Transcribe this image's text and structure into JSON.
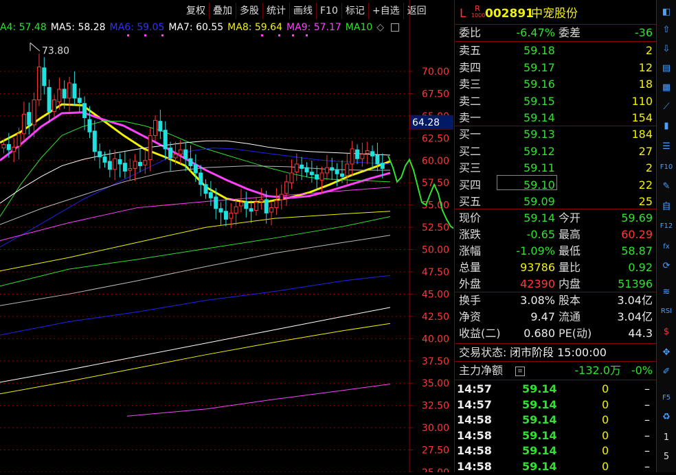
{
  "toolbar_top": [
    "复权",
    "叠加",
    "多股",
    "统计",
    "画线",
    "F10",
    "标记",
    "+自选",
    "返回"
  ],
  "ma_legend": [
    {
      "label": "A4: 57.48",
      "color": "#2fe22f"
    },
    {
      "label": "MA5: 58.28",
      "color": "#ffffff"
    },
    {
      "label": "MA6: 59.05",
      "color": "#3030ff"
    },
    {
      "label": "MA7: 60.55",
      "color": "#ffffff"
    },
    {
      "label": "MA8: 59.64",
      "color": "#f2f200"
    },
    {
      "label": "MA9: 57.17",
      "color": "#ff40ff"
    },
    {
      "label": "MA10",
      "color": "#2fe22f"
    }
  ],
  "chart_data": {
    "type": "candlestick",
    "y_ticks": [
      "70.00",
      "67.50",
      "65.00",
      "62.50",
      "60.00",
      "57.50",
      "55.00",
      "52.50",
      "50.00",
      "47.50",
      "45.00",
      "42.50",
      "40.00",
      "37.50",
      "35.00",
      "32.50",
      "30.00",
      "27.50",
      "25.00"
    ],
    "ylim": [
      25.0,
      72.6
    ],
    "high_label": "73.80",
    "current_price_label": "64.28",
    "closes": [
      61.8,
      61.2,
      61.5,
      63.0,
      65.2,
      64.0,
      66.8,
      70.5,
      68.4,
      65.5,
      66.8,
      68.0,
      67.0,
      68.7,
      67.0,
      66.5,
      64.8,
      63.2,
      61.0,
      60.4,
      59.8,
      59.0,
      60.2,
      59.6,
      58.8,
      59.1,
      59.9,
      59.4,
      60.0,
      62.8,
      64.5,
      63.3,
      61.3,
      60.3,
      60.7,
      61.2,
      60.2,
      59.4,
      58.6,
      57.3,
      56.3,
      55.8,
      54.6,
      54.2,
      53.4,
      54.1,
      54.8,
      55.3,
      54.6,
      54.3,
      55.3,
      55.6,
      54.1,
      54.7,
      55.5,
      56.2,
      57.6,
      58.6,
      59.6,
      59.1,
      58.7,
      58.4,
      57.9,
      58.6,
      59.2,
      58.9,
      58.5,
      58.2,
      59.6,
      61.3,
      60.2,
      60.7,
      61.1,
      60.5,
      59.6,
      59.1
    ],
    "opens": [
      61.4,
      61.8,
      61.0,
      61.6,
      63.0,
      65.4,
      64.0,
      66.8,
      70.4,
      68.2,
      65.5,
      66.6,
      68.0,
      67.0,
      68.6,
      67.0,
      66.4,
      64.6,
      63.3,
      61.0,
      60.4,
      59.9,
      59.0,
      60.1,
      59.7,
      58.9,
      59.1,
      59.8,
      59.5,
      60.1,
      62.8,
      64.4,
      63.4,
      61.4,
      60.3,
      60.7,
      61.2,
      60.2,
      59.5,
      58.6,
      57.3,
      56.4,
      55.9,
      54.6,
      54.3,
      53.5,
      54.1,
      54.9,
      55.3,
      54.6,
      54.4,
      55.4,
      55.6,
      54.2,
      54.7,
      55.6,
      56.3,
      57.5,
      58.7,
      59.5,
      59.2,
      58.7,
      58.4,
      57.8,
      58.6,
      59.2,
      58.9,
      58.5,
      58.3,
      59.6,
      61.2,
      60.2,
      60.8,
      61.0,
      60.6,
      59.7
    ],
    "forecast_path": [
      [
        565,
        60.5
      ],
      [
        572,
        59.2
      ],
      [
        578,
        57.6
      ],
      [
        584,
        58.1
      ],
      [
        590,
        59.4
      ],
      [
        596,
        60.1
      ],
      [
        602,
        58.9
      ],
      [
        608,
        57.1
      ],
      [
        614,
        55.3
      ],
      [
        620,
        55.0
      ],
      [
        626,
        56.2
      ],
      [
        632,
        57.3
      ],
      [
        638,
        56.3
      ],
      [
        644,
        54.4
      ],
      [
        650,
        53.4
      ],
      [
        656,
        52.6
      ],
      [
        662,
        52.3
      ],
      [
        668,
        51.6
      ],
      [
        676,
        50.9
      ],
      [
        684,
        50.1
      ],
      [
        692,
        49.3
      ],
      [
        700,
        48.9
      ],
      [
        708,
        48.1
      ],
      [
        716,
        46.8
      ],
      [
        722,
        46.5
      ]
    ],
    "ma_lines": [
      {
        "name": "MA8",
        "color": "#f2f200",
        "width": 3,
        "values": [
          [
            0,
            62.0
          ],
          [
            30,
            63.2
          ],
          [
            60,
            64.8
          ],
          [
            90,
            66.3
          ],
          [
            120,
            66.2
          ],
          [
            150,
            64.5
          ],
          [
            180,
            62.8
          ],
          [
            210,
            61.3
          ],
          [
            240,
            60.4
          ],
          [
            270,
            59.4
          ],
          [
            300,
            57.0
          ],
          [
            330,
            55.7
          ],
          [
            360,
            55.3
          ],
          [
            390,
            55.4
          ],
          [
            420,
            55.8
          ],
          [
            450,
            56.4
          ],
          [
            480,
            57.3
          ],
          [
            510,
            58.3
          ],
          [
            540,
            59.1
          ],
          [
            568,
            59.9
          ]
        ]
      },
      {
        "name": "MA9",
        "color": "#ff40ff",
        "width": 3,
        "values": [
          [
            0,
            60.0
          ],
          [
            30,
            61.8
          ],
          [
            60,
            63.8
          ],
          [
            90,
            65.3
          ],
          [
            120,
            65.4
          ],
          [
            150,
            64.6
          ],
          [
            180,
            63.9
          ],
          [
            210,
            62.7
          ],
          [
            240,
            61.5
          ],
          [
            270,
            60.2
          ],
          [
            300,
            58.9
          ],
          [
            330,
            57.8
          ],
          [
            360,
            56.8
          ],
          [
            390,
            56.0
          ],
          [
            420,
            55.8
          ],
          [
            450,
            56.0
          ],
          [
            480,
            56.6
          ],
          [
            510,
            57.3
          ],
          [
            540,
            58.0
          ],
          [
            568,
            58.6
          ]
        ]
      },
      {
        "name": "MA10",
        "color": "#2fe22f",
        "width": 1,
        "values": [
          [
            0,
            53.7
          ],
          [
            30,
            57.3
          ],
          [
            60,
            60.3
          ],
          [
            90,
            62.8
          ],
          [
            120,
            63.8
          ],
          [
            150,
            64.4
          ],
          [
            180,
            64.4
          ],
          [
            210,
            63.9
          ],
          [
            240,
            63.2
          ],
          [
            270,
            62.2
          ],
          [
            300,
            61.3
          ],
          [
            330,
            60.6
          ],
          [
            360,
            59.9
          ],
          [
            390,
            59.2
          ],
          [
            420,
            58.6
          ],
          [
            450,
            58.1
          ],
          [
            480,
            57.9
          ],
          [
            510,
            57.8
          ],
          [
            540,
            57.7
          ],
          [
            568,
            57.6
          ]
        ]
      },
      {
        "name": "MA7",
        "color": "#ffffff",
        "width": 1,
        "values": [
          [
            0,
            55.2
          ],
          [
            30,
            56.8
          ],
          [
            60,
            58.2
          ],
          [
            90,
            59.4
          ],
          [
            120,
            60.1
          ],
          [
            150,
            60.6
          ],
          [
            180,
            61.0
          ],
          [
            210,
            61.4
          ],
          [
            240,
            61.7
          ],
          [
            270,
            62.0
          ],
          [
            300,
            62.2
          ],
          [
            330,
            62.2
          ],
          [
            360,
            61.9
          ],
          [
            390,
            61.5
          ],
          [
            420,
            61.2
          ],
          [
            450,
            61.0
          ],
          [
            480,
            60.9
          ],
          [
            510,
            60.8
          ],
          [
            540,
            60.7
          ],
          [
            568,
            60.6
          ]
        ]
      },
      {
        "name": "MA6",
        "color": "#2222ee",
        "width": 1,
        "values": [
          [
            0,
            50.3
          ],
          [
            40,
            52.0
          ],
          [
            80,
            53.8
          ],
          [
            120,
            55.6
          ],
          [
            160,
            57.1
          ],
          [
            200,
            58.6
          ],
          [
            240,
            60.1
          ],
          [
            280,
            61.1
          ],
          [
            310,
            61.4
          ],
          [
            340,
            61.3
          ],
          [
            370,
            61.0
          ],
          [
            400,
            60.7
          ],
          [
            430,
            60.4
          ],
          [
            460,
            60.1
          ],
          [
            490,
            59.9
          ],
          [
            520,
            59.8
          ],
          [
            568,
            59.6
          ]
        ]
      },
      {
        "name": "MA5",
        "color": "#bbbbbb",
        "width": 1,
        "values": [
          [
            0,
            52.8
          ],
          [
            60,
            54.6
          ],
          [
            120,
            56.1
          ],
          [
            180,
            57.6
          ],
          [
            240,
            58.7
          ],
          [
            300,
            59.2
          ],
          [
            360,
            59.4
          ],
          [
            420,
            59.3
          ],
          [
            480,
            59.0
          ],
          [
            530,
            58.9
          ],
          [
            568,
            58.9
          ]
        ]
      },
      {
        "name": "L1",
        "color": "#ff40ff",
        "width": 1,
        "values": [
          [
            0,
            51.0
          ],
          [
            100,
            53.0
          ],
          [
            200,
            54.7
          ],
          [
            300,
            55.4
          ],
          [
            400,
            56.0
          ],
          [
            500,
            56.6
          ],
          [
            568,
            57.0
          ]
        ]
      },
      {
        "name": "L2",
        "color": "#f2f200",
        "width": 1,
        "values": [
          [
            0,
            47.6
          ],
          [
            100,
            49.1
          ],
          [
            200,
            50.8
          ],
          [
            300,
            52.5
          ],
          [
            400,
            53.5
          ],
          [
            500,
            54.0
          ],
          [
            568,
            54.3
          ]
        ]
      },
      {
        "name": "L3",
        "color": "#2fe22f",
        "width": 1,
        "values": [
          [
            0,
            45.9
          ],
          [
            100,
            47.8
          ],
          [
            200,
            48.9
          ],
          [
            300,
            50.1
          ],
          [
            400,
            51.3
          ],
          [
            500,
            52.6
          ],
          [
            568,
            53.7
          ]
        ]
      },
      {
        "name": "L4",
        "color": "#bbbbbb",
        "width": 1,
        "values": [
          [
            0,
            43.7
          ],
          [
            100,
            45.0
          ],
          [
            200,
            46.5
          ],
          [
            300,
            48.1
          ],
          [
            400,
            49.6
          ],
          [
            500,
            50.8
          ],
          [
            568,
            51.6
          ]
        ]
      },
      {
        "name": "L5",
        "color": "#2222ee",
        "width": 1,
        "values": [
          [
            0,
            40.4
          ],
          [
            100,
            41.9
          ],
          [
            200,
            43.0
          ],
          [
            300,
            44.3
          ],
          [
            400,
            45.3
          ],
          [
            500,
            46.5
          ],
          [
            568,
            47.1
          ]
        ]
      },
      {
        "name": "L6",
        "color": "#f2f200",
        "width": 1,
        "values": [
          [
            0,
            33.8
          ],
          [
            100,
            35.2
          ],
          [
            200,
            36.7
          ],
          [
            300,
            38.2
          ],
          [
            400,
            39.6
          ],
          [
            500,
            40.9
          ],
          [
            568,
            41.7
          ]
        ]
      },
      {
        "name": "L7",
        "color": "#ffffff",
        "width": 1,
        "values": [
          [
            0,
            35.1
          ],
          [
            100,
            36.5
          ],
          [
            200,
            38.0
          ],
          [
            300,
            39.5
          ],
          [
            400,
            41.0
          ],
          [
            500,
            42.5
          ],
          [
            568,
            43.5
          ]
        ]
      },
      {
        "name": "L8",
        "color": "#ff40ff",
        "width": 1,
        "values": [
          [
            185,
            31.3
          ],
          [
            300,
            32.1
          ],
          [
            400,
            33.2
          ],
          [
            500,
            34.2
          ],
          [
            568,
            34.9
          ]
        ]
      }
    ]
  },
  "quote": {
    "code": "002891",
    "name": "中宠股份",
    "badge_top": "R",
    "badge_bottom": "1000",
    "prefix": "L",
    "weibi_label": "委比",
    "weibi_value": "-6.47%",
    "weicha_label": "委差",
    "weicha_value": "-36",
    "asks": [
      {
        "label": "卖五",
        "price": "59.18",
        "vol": "2"
      },
      {
        "label": "卖四",
        "price": "59.17",
        "vol": "12"
      },
      {
        "label": "卖三",
        "price": "59.16",
        "vol": "18"
      },
      {
        "label": "卖二",
        "price": "59.15",
        "vol": "110"
      },
      {
        "label": "卖一",
        "price": "59.14",
        "vol": "154"
      }
    ],
    "bids": [
      {
        "label": "买一",
        "price": "59.13",
        "vol": "184"
      },
      {
        "label": "买二",
        "price": "59.12",
        "vol": "27"
      },
      {
        "label": "买三",
        "price": "59.11",
        "vol": "2"
      },
      {
        "label": "买四",
        "price": "59.10",
        "vol": "22"
      },
      {
        "label": "买五",
        "price": "59.09",
        "vol": "25"
      }
    ],
    "stats": [
      {
        "l1": "现价",
        "v1": "59.14",
        "c1": "green",
        "l2": "今开",
        "v2": "59.69",
        "c2": "green"
      },
      {
        "l1": "涨跌",
        "v1": "-0.65",
        "c1": "green",
        "l2": "最高",
        "v2": "60.29",
        "c2": "red"
      },
      {
        "l1": "涨幅",
        "v1": "-1.09%",
        "c1": "green",
        "l2": "最低",
        "v2": "58.87",
        "c2": "green"
      },
      {
        "l1": "总量",
        "v1": "93786",
        "c1": "yellow",
        "l2": "量比",
        "v2": "0.92",
        "c2": "green"
      },
      {
        "l1": "外盘",
        "v1": "42390",
        "c1": "red",
        "l2": "内盘",
        "v2": "51396",
        "c2": "green"
      }
    ],
    "stats2": [
      {
        "l1": "换手",
        "v1": "3.08%",
        "l2": "股本",
        "v2": "3.04亿"
      },
      {
        "l1": "净资",
        "v1": "9.47",
        "l2": "流通",
        "v2": "3.04亿"
      },
      {
        "l1": "收益(二)",
        "v1": "0.680",
        "l2": "PE(动)",
        "v2": "44.3"
      }
    ],
    "status_label": "交易状态:",
    "status_value": "闭市阶段 15:00:00",
    "netflow_label": "主力净额",
    "netflow_value": "-132.0万",
    "netflow_pct": "-0%",
    "ticks": [
      {
        "time": "14:57",
        "price": "59.14",
        "vol": "0",
        "flag": "–"
      },
      {
        "time": "14:57",
        "price": "59.14",
        "vol": "0",
        "flag": "–"
      },
      {
        "time": "14:58",
        "price": "59.14",
        "vol": "0",
        "flag": "–"
      },
      {
        "time": "14:58",
        "price": "59.14",
        "vol": "0",
        "flag": "–"
      },
      {
        "time": "14:58",
        "price": "59.14",
        "vol": "0",
        "flag": "–"
      },
      {
        "time": "14:58",
        "price": "59.14",
        "vol": "0",
        "flag": "–"
      }
    ]
  },
  "side_tools": [
    {
      "icon": "dock-icon",
      "glyph": "◧"
    },
    {
      "icon": "arrow-up-icon",
      "glyph": "⇧"
    },
    {
      "icon": "arrow-down-icon",
      "glyph": "⇩"
    },
    {
      "icon": "document-icon",
      "glyph": "▤"
    },
    {
      "icon": "grid-icon",
      "glyph": "▦"
    },
    {
      "icon": "line-chart-icon",
      "glyph": "⟋"
    },
    {
      "icon": "candle-icon",
      "glyph": "▮"
    },
    {
      "icon": "list-icon",
      "glyph": "☰"
    },
    {
      "icon": "f10-icon",
      "glyph": "F10"
    },
    {
      "icon": "note-icon",
      "glyph": "✎"
    },
    {
      "icon": "self-icon",
      "glyph": "自"
    },
    {
      "icon": "f12-icon",
      "glyph": "F12"
    },
    {
      "icon": "formula-icon",
      "glyph": "fx"
    },
    {
      "icon": "refresh-icon",
      "glyph": "⟳"
    },
    {
      "icon": "wave-icon",
      "glyph": "≋"
    },
    {
      "icon": "rsi-icon",
      "glyph": "RSI"
    },
    {
      "icon": "money-icon",
      "glyph": "$"
    },
    {
      "icon": "move-icon",
      "glyph": "✥"
    },
    {
      "icon": "pen-icon",
      "glyph": "✐"
    },
    {
      "icon": "f5-icon",
      "glyph": "F5"
    },
    {
      "icon": "recycle-icon",
      "glyph": "♻"
    },
    {
      "icon": "page-1-icon",
      "glyph": "1"
    },
    {
      "icon": "page-5-icon",
      "glyph": "5"
    }
  ]
}
